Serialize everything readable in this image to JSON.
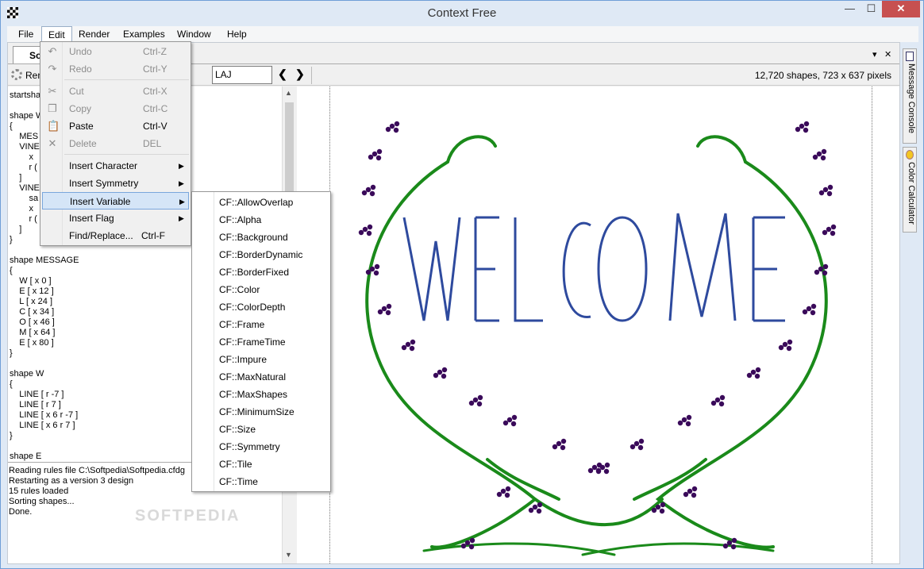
{
  "window": {
    "title": "Context Free",
    "min": "—",
    "max": "☐",
    "close": "✕"
  },
  "menubar": [
    "File",
    "Edit",
    "Render",
    "Examples",
    "Window",
    "Help"
  ],
  "doc_tab": "Sof",
  "tabstrip": {
    "dropdown": "▾",
    "close": "✕"
  },
  "toolbar": {
    "render": "Ren",
    "variation": "LAJ",
    "prev": "❮",
    "next": "❯",
    "status": "12,720 shapes, 723 x 637 pixels"
  },
  "editor_lines": [
    "startshap",
    "",
    "shape W",
    "{",
    "    MES",
    "    VINE",
    "        x",
    "        r (",
    "    ]",
    "    VINE",
    "        sa",
    "        x",
    "        r (",
    "    ]",
    "}",
    "",
    "shape MESSAGE",
    "{",
    "    W [ x 0 ]",
    "    E [ x 12 ]",
    "    L [ x 24 ]",
    "    C [ x 34 ]",
    "    O [ x 46 ]",
    "    M [ x 64 ]",
    "    E [ x 80 ]",
    "}",
    "",
    "shape W",
    "{",
    "    LINE [ r -7 ]",
    "    LINE [ r 7 ]",
    "    LINE [ x 6 r -7 ]",
    "    LINE [ x 6 r 7 ]",
    "}",
    "",
    "shape E"
  ],
  "console_lines": [
    "Reading rules file C:\\Softpedia\\Softpedia.cfdg",
    "Restarting as a version 3 design",
    "15 rules loaded",
    "Sorting shapes...",
    "Done."
  ],
  "watermark": "SOFTPEDIA",
  "canvas_word": "WELCOME",
  "colors": {
    "letters": "#2e4a9e",
    "vine": "#1a8a1a",
    "berries": "#3a0a5a"
  },
  "dock": {
    "message_console": "Message Console",
    "color_calculator": "Color Calculator"
  },
  "edit_menu": [
    {
      "label": "Undo",
      "shortcut": "Ctrl-Z",
      "icon": "undo-icon",
      "glyph": "↶",
      "disabled": true
    },
    {
      "label": "Redo",
      "shortcut": "Ctrl-Y",
      "icon": "redo-icon",
      "glyph": "↷",
      "disabled": true
    },
    {
      "label": "Cut",
      "shortcut": "Ctrl-X",
      "icon": "cut-icon",
      "glyph": "✂",
      "disabled": true
    },
    {
      "label": "Copy",
      "shortcut": "Ctrl-C",
      "icon": "copy-icon",
      "glyph": "❐",
      "disabled": true
    },
    {
      "label": "Paste",
      "shortcut": "Ctrl-V",
      "icon": "paste-icon",
      "glyph": "📋",
      "disabled": false
    },
    {
      "label": "Delete",
      "shortcut": "DEL",
      "icon": "delete-icon",
      "glyph": "✕",
      "disabled": true
    },
    {
      "label": "Insert Character",
      "submenu": true
    },
    {
      "label": "Insert Symmetry",
      "submenu": true
    },
    {
      "label": "Insert Variable",
      "submenu": true,
      "highlighted": true
    },
    {
      "label": "Insert Flag",
      "submenu": true
    },
    {
      "label": "Find/Replace...",
      "shortcut": "Ctrl-F"
    }
  ],
  "variable_submenu": [
    "CF::AllowOverlap",
    "CF::Alpha",
    "CF::Background",
    "CF::BorderDynamic",
    "CF::BorderFixed",
    "CF::Color",
    "CF::ColorDepth",
    "CF::Frame",
    "CF::FrameTime",
    "CF::Impure",
    "CF::MaxNatural",
    "CF::MaxShapes",
    "CF::MinimumSize",
    "CF::Size",
    "CF::Symmetry",
    "CF::Tile",
    "CF::Time"
  ]
}
